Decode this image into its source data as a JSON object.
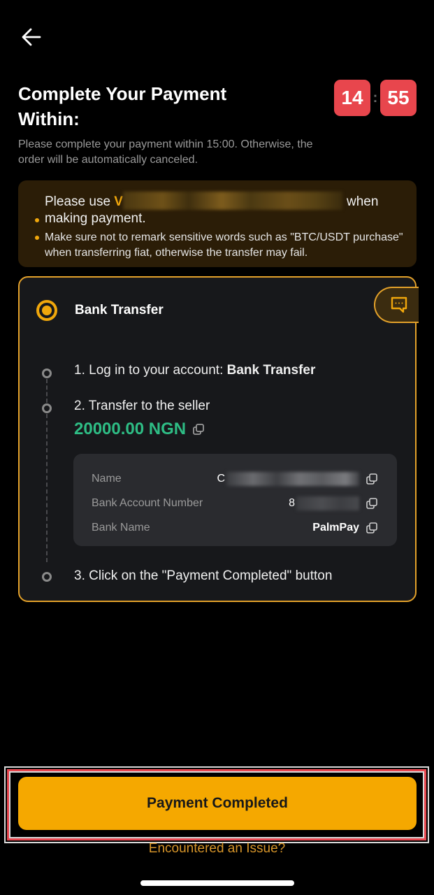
{
  "header": {
    "back_icon": "arrow-left-icon",
    "title": "Complete Your Payment Within:",
    "timer": {
      "minutes": "14",
      "separator": ":",
      "seconds": "55"
    },
    "subtitle": "Please complete your payment within 15:00. Otherwise, the order will be automatically canceled."
  },
  "notice": {
    "item1_prefix": "Please use ",
    "item1_highlight": "V",
    "item1_suffix": "when making payment.",
    "item2": "Make sure not to remark sensitive words such as \"BTC/USDT purchase\" when transferring fiat, otherwise the transfer may fail."
  },
  "payment_card": {
    "method_label": "Bank Transfer",
    "chat_icon": "chat-bubble-icon",
    "steps": [
      {
        "prefix": "1. Log in to your account: ",
        "bold": "Bank Transfer"
      },
      {
        "prefix": "2. Transfer to the seller",
        "bold": ""
      },
      {
        "prefix": "3. Click on the \"Payment Completed\" button",
        "bold": ""
      }
    ],
    "amount": "20000.00 NGN",
    "details": [
      {
        "label": "Name",
        "value": "C"
      },
      {
        "label": "Bank Account Number",
        "value": "8"
      },
      {
        "label": "Bank Name",
        "value": "PalmPay"
      }
    ]
  },
  "footer": {
    "primary_button": "Payment Completed",
    "issue_link": "Encountered an Issue?"
  },
  "colors": {
    "accent": "#f0a70c",
    "timer": "#e8464d",
    "amount": "#2ebd85",
    "button": "#f5a800"
  }
}
